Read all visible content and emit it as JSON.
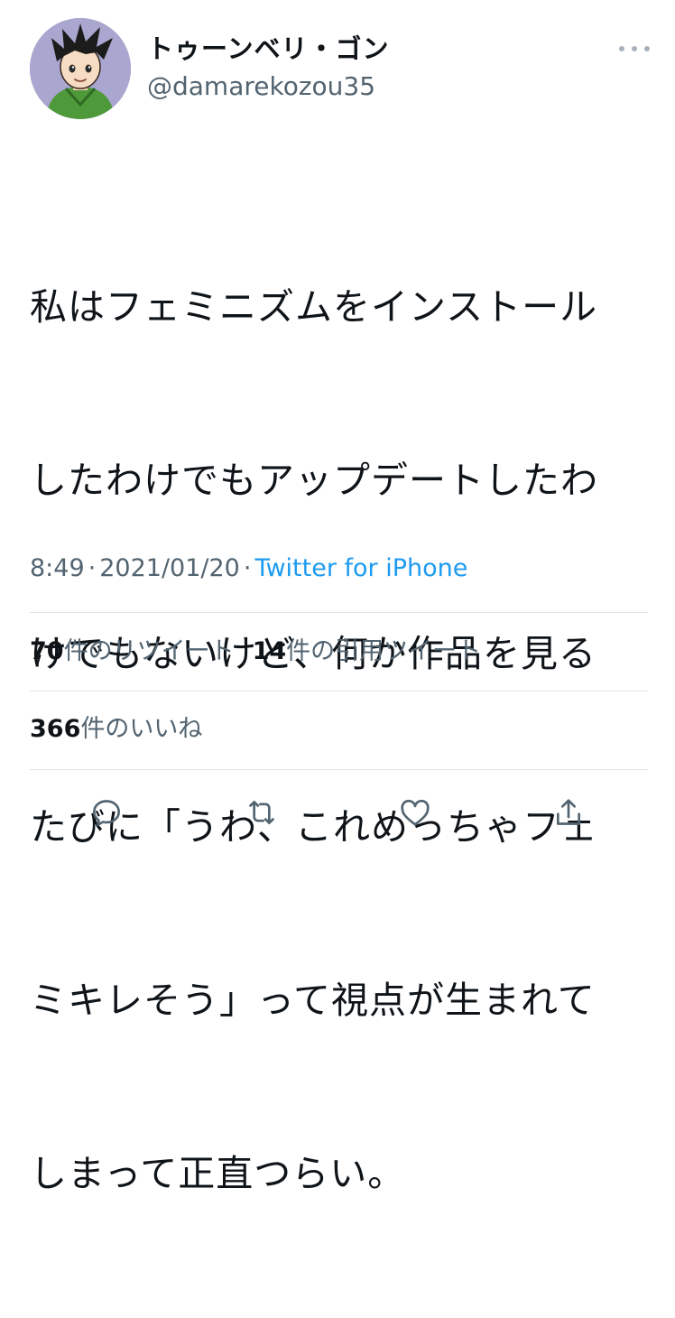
{
  "author": {
    "display_name": "トゥーンベリ・ゴン",
    "handle": "@damarekozou35",
    "avatar_icon": "cartoon-boy-avatar"
  },
  "tweet": {
    "text_lines": [
      "私はフェミニズムをインストール",
      "したわけでもアップデートしたわ",
      "けでもないけど、何か作品を見る",
      "たびに「うわ、これめっちゃフェ",
      "ミキレそう」って視点が生まれて",
      "しまって正直つらい。"
    ],
    "time": "8:49",
    "date": "2021/01/20",
    "separator": "·",
    "source": "Twitter for iPhone"
  },
  "stats": {
    "retweets_count": "70",
    "retweets_label": "件のリツイート",
    "quotes_count": "14",
    "quotes_label": "件の引用ツイート",
    "likes_count": "366",
    "likes_label": "件のいいね"
  },
  "actions": [
    "reply-icon",
    "retweet-icon",
    "like-icon",
    "share-icon"
  ],
  "colors": {
    "text": "#0f1419",
    "secondary": "#536471",
    "link": "#1d9bf0",
    "divider": "#dfe3e7",
    "icon": "#536471"
  }
}
